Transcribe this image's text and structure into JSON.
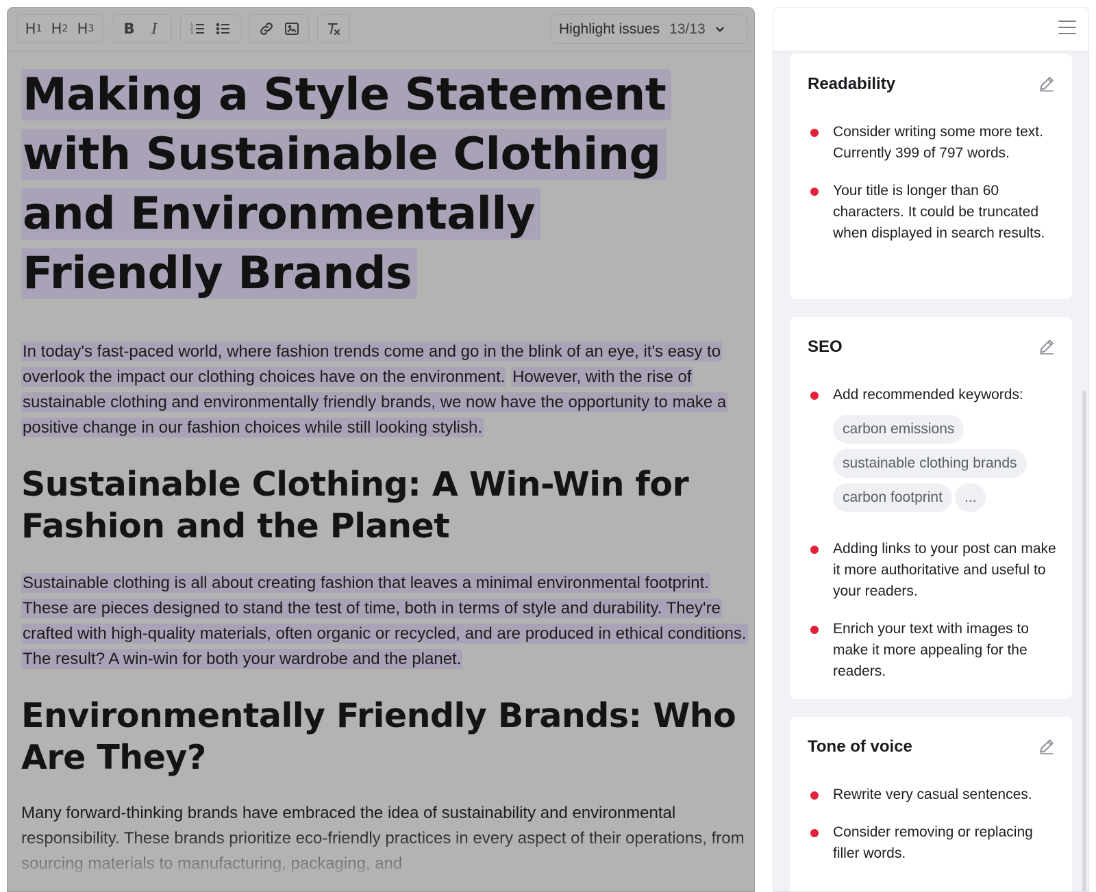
{
  "toolbar": {
    "h1": "H",
    "h1_sub": "1",
    "h2": "H",
    "h2_sub": "2",
    "h3": "H",
    "h3_sub": "3",
    "bold": "B",
    "italic": "I",
    "highlight_label": "Highlight issues",
    "highlight_count": "13/13"
  },
  "article": {
    "title": "Making a Style Statement with Sustainable Clothing and Environmentally Friendly Brands",
    "intro_1": "In today's fast-paced world, where fashion trends come and go in the blink of an eye, it's easy to overlook the impact our clothing choices have on the environment.",
    "intro_2": "However, with the rise of sustainable clothing and environmentally friendly brands, we now have the opportunity to make a positive change in our fashion choices while still looking stylish.",
    "section1_heading": "Sustainable Clothing: A Win-Win for Fashion and the Planet",
    "section1_body": "Sustainable clothing is all about creating fashion that leaves a minimal environmental footprint. These are pieces designed to stand the test of time, both in terms of style and durability. They're crafted with high-quality materials, often organic or recycled, and are produced in ethical conditions. The result? A win-win for both your wardrobe and the planet.",
    "section2_heading": "Environmentally Friendly Brands: Who Are They?",
    "section2_body": "Many forward-thinking brands have embraced the idea of sustainability and environmental responsibility. These brands prioritize eco-friendly practices in every aspect of their operations, from sourcing materials to manufacturing, packaging, and"
  },
  "sidebar": {
    "readability": {
      "title": "Readability",
      "items": [
        "Consider writing some more text. Currently 399 of 797 words.",
        "Your title is longer than 60 characters. It could be truncated when displayed in search results."
      ]
    },
    "seo": {
      "title": "SEO",
      "keywords_label": "Add recommended keywords:",
      "keywords": [
        "carbon emissions",
        "sustainable clothing brands",
        "carbon footprint",
        "..."
      ],
      "items": [
        "Adding links to your post can make it more authoritative and useful to your readers.",
        "Enrich your text with images to make it more appealing for the readers."
      ]
    },
    "tone": {
      "title": "Tone of voice",
      "items": [
        "Rewrite very casual sentences.",
        "Consider removing or replacing filler words."
      ]
    }
  },
  "colors": {
    "issue_dot": "#e2223d",
    "highlight": "#9b87be",
    "editor_overlay": "#b3b3b3"
  }
}
